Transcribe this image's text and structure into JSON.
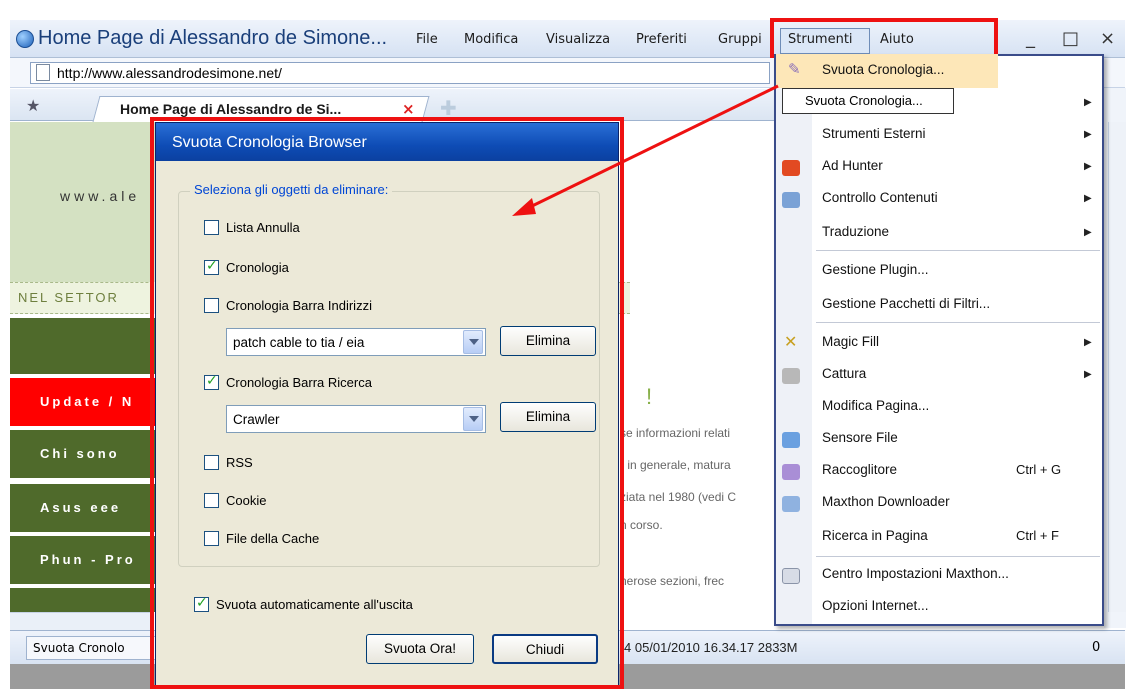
{
  "window": {
    "title": "Home Page di Alessandro de Simone...",
    "menus": [
      "File",
      "Modifica",
      "Visualizza",
      "Preferiti",
      "Gruppi",
      "Strumenti",
      "Aiuto"
    ],
    "controls": [
      "_",
      "□",
      "×"
    ]
  },
  "address": {
    "url": "http://www.alessandrodesimone.net/"
  },
  "tab": {
    "label": "Home Page di Alessandro de Si...",
    "close": "×"
  },
  "page": {
    "banner_text": "www.ale",
    "nel_text": "NEL SETTOR",
    "nav": [
      "Update / N",
      "Chi sono",
      "Asus eee",
      "Phun - Pro"
    ],
    "exclaim": "!",
    "text_lines": [
      "se informazioni relati",
      "r in generale, matura",
      "ziata nel 1980 (vedi C",
      "n corso.",
      "nerose sezioni, frec"
    ]
  },
  "status": {
    "left": "Svuota Cronolo",
    "right": "4  05/01/2010 16.34.17 2833M",
    "count": "0"
  },
  "dropdown": {
    "highlighted": "Svuota Cronologia...",
    "tooltip": "Svuota Cronologia...",
    "items": [
      {
        "label": "Strumenti Esterni",
        "submenu": true
      },
      {
        "label": "Ad Hunter",
        "submenu": true
      },
      {
        "label": "Controllo Contenuti",
        "submenu": true
      },
      {
        "label": "Traduzione",
        "submenu": true
      },
      {
        "label": "Gestione Plugin...",
        "submenu": false
      },
      {
        "label": "Gestione Pacchetti di Filtri...",
        "submenu": false
      },
      {
        "label": "Magic Fill",
        "submenu": true
      },
      {
        "label": "Cattura",
        "submenu": true
      },
      {
        "label": "Modifica Pagina...",
        "submenu": false
      },
      {
        "label": "Sensore File",
        "submenu": false
      },
      {
        "label": "Raccoglitore",
        "shortcut": "Ctrl + G"
      },
      {
        "label": "Maxthon Downloader"
      },
      {
        "label": "Ricerca in Pagina",
        "shortcut": "Ctrl + F"
      },
      {
        "label": "Centro Impostazioni Maxthon..."
      },
      {
        "label": "Opzioni Internet..."
      }
    ]
  },
  "dialog": {
    "title": "Svuota Cronologia Browser",
    "group_label": "Seleziona gli oggetti da eliminare:",
    "options": [
      {
        "label": "Lista Annulla",
        "checked": false
      },
      {
        "label": "Cronologia",
        "checked": true
      },
      {
        "label": "Cronologia Barra Indirizzi",
        "checked": false
      },
      {
        "label": "Cronologia Barra Ricerca",
        "checked": true
      },
      {
        "label": "RSS",
        "checked": false
      },
      {
        "label": "Cookie",
        "checked": false
      },
      {
        "label": "File della Cache",
        "checked": false
      }
    ],
    "address_combo": "patch cable to tia / eia",
    "search_combo": "Crawler",
    "delete_label": "Elimina",
    "auto_clear": {
      "label": "Svuota automaticamente all'uscita",
      "checked": true
    },
    "clear_now": "Svuota Ora!",
    "close": "Chiudi"
  },
  "colors": {
    "highlight_frame": "#ee1111",
    "menu_hover": "#fde7b8",
    "dialog_title": "#0e4cb5"
  }
}
